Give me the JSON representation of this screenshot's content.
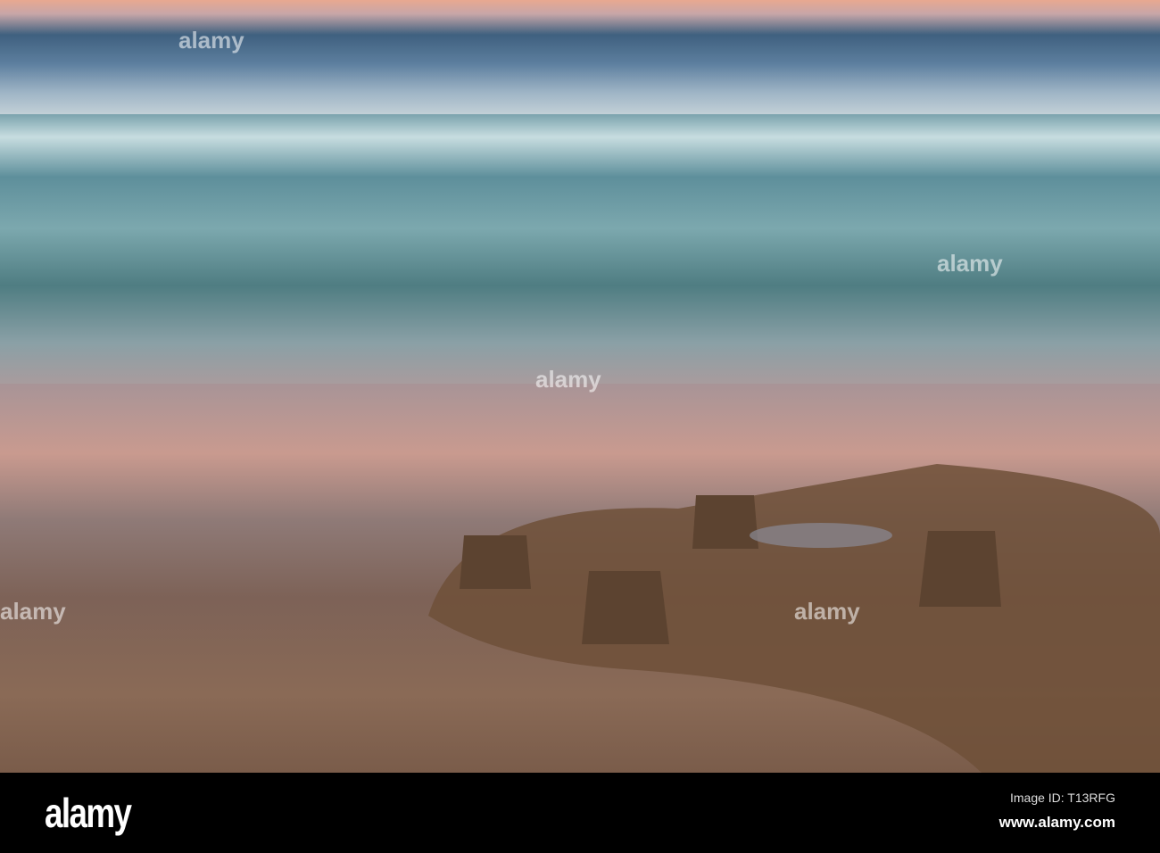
{
  "footer": {
    "logo": "alamy",
    "image_id": "Image ID: T13RFG",
    "url": "www.alamy.com"
  },
  "watermark": "alamy"
}
